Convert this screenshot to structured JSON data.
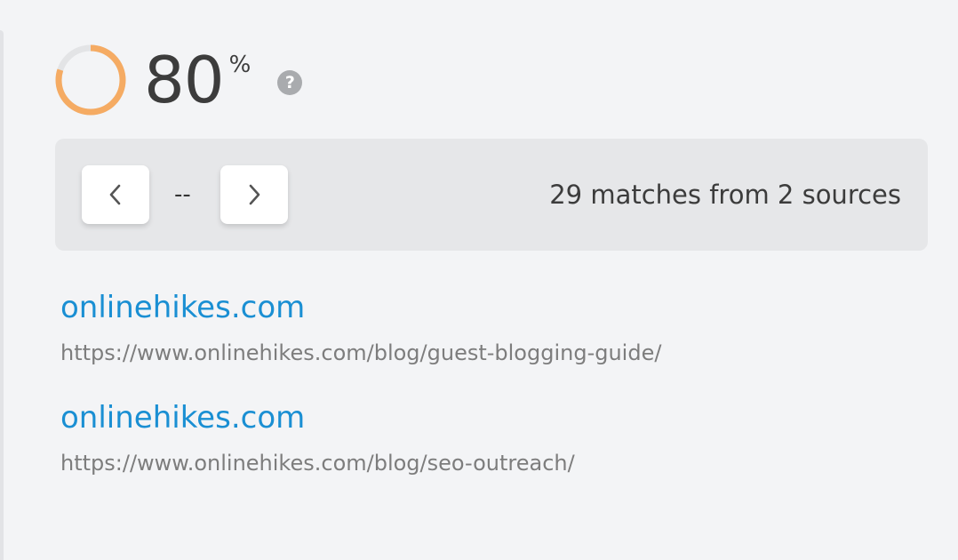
{
  "score": {
    "value": "80",
    "unit": "%",
    "progress_fraction": 0.8,
    "ring_color": "#f5ab63",
    "track_color": "#e3e4e6",
    "help_icon": "question-circle-icon",
    "help_glyph": "?"
  },
  "navigation": {
    "prev_icon": "chevron-left-icon",
    "next_icon": "chevron-right-icon",
    "current_indicator": "--",
    "summary": "29 matches from 2 sources"
  },
  "sources": [
    {
      "title": "onlinehikes.com",
      "url": "https://www.onlinehikes.com/blog/guest-blogging-guide/"
    },
    {
      "title": "onlinehikes.com",
      "url": "https://www.onlinehikes.com/blog/seo-outreach/"
    }
  ],
  "colors": {
    "link": "#1a8fd3",
    "url_text": "#7d7d7d",
    "background": "#f3f4f6",
    "panel": "#e6e7e9"
  }
}
